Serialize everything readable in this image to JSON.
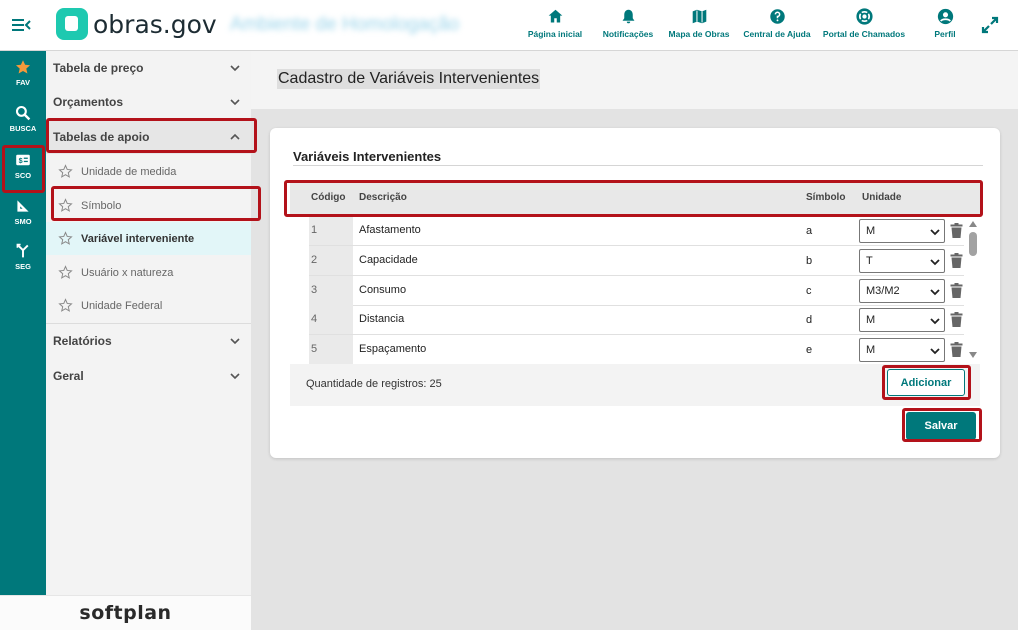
{
  "header": {
    "brand": "obras.gov",
    "environment": "Ambiente de Homologação",
    "nav": [
      {
        "label": "Página inicial",
        "icon": "home-icon"
      },
      {
        "label": "Notificações",
        "icon": "bell-icon"
      },
      {
        "label": "Mapa de Obras",
        "icon": "map-icon"
      },
      {
        "label": "Central de Ajuda",
        "icon": "help-icon"
      },
      {
        "label": "Portal de Chamados",
        "icon": "lifebuoy-icon"
      },
      {
        "label": "Perfil",
        "icon": "user-icon"
      }
    ]
  },
  "rail": [
    {
      "label": "FAV",
      "icon": "star-icon"
    },
    {
      "label": "BUSCA",
      "icon": "search-icon"
    },
    {
      "label": "SCO",
      "icon": "budget-icon"
    },
    {
      "label": "SMO",
      "icon": "ruler-icon"
    },
    {
      "label": "SEG",
      "icon": "merge-icon"
    }
  ],
  "sidebar": {
    "sections": [
      {
        "label": "Tabela de preço"
      },
      {
        "label": "Orçamentos"
      },
      {
        "label": "Tabelas de apoio"
      },
      {
        "label": "Relatórios"
      },
      {
        "label": "Geral"
      }
    ],
    "items": [
      {
        "label": "Unidade de medida"
      },
      {
        "label": "Símbolo"
      },
      {
        "label": "Variável interveniente"
      },
      {
        "label": "Usuário x natureza"
      },
      {
        "label": "Unidade Federal"
      }
    ],
    "footer_brand": "softplan"
  },
  "page": {
    "title": "Cadastro de Variáveis Intervenientes",
    "card_title": "Variáveis Intervenientes",
    "columns": {
      "code": "Código",
      "description": "Descrição",
      "symbol": "Símbolo",
      "unit": "Unidade"
    },
    "rows": [
      {
        "code": "1",
        "description": "Afastamento",
        "symbol": "a",
        "unit": "M"
      },
      {
        "code": "2",
        "description": "Capacidade",
        "symbol": "b",
        "unit": "T"
      },
      {
        "code": "3",
        "description": "Consumo",
        "symbol": "c",
        "unit": "M3/M2"
      },
      {
        "code": "4",
        "description": "Distancia",
        "symbol": "d",
        "unit": "M"
      },
      {
        "code": "5",
        "description": "Espaçamento",
        "symbol": "e",
        "unit": "M"
      }
    ],
    "record_count": "Quantidade de registros: 25",
    "add_label": "Adicionar",
    "save_label": "Salvar"
  },
  "colors": {
    "primary": "#00787b",
    "highlight": "#b3121a",
    "brand_mark": "#1ec9b0"
  }
}
